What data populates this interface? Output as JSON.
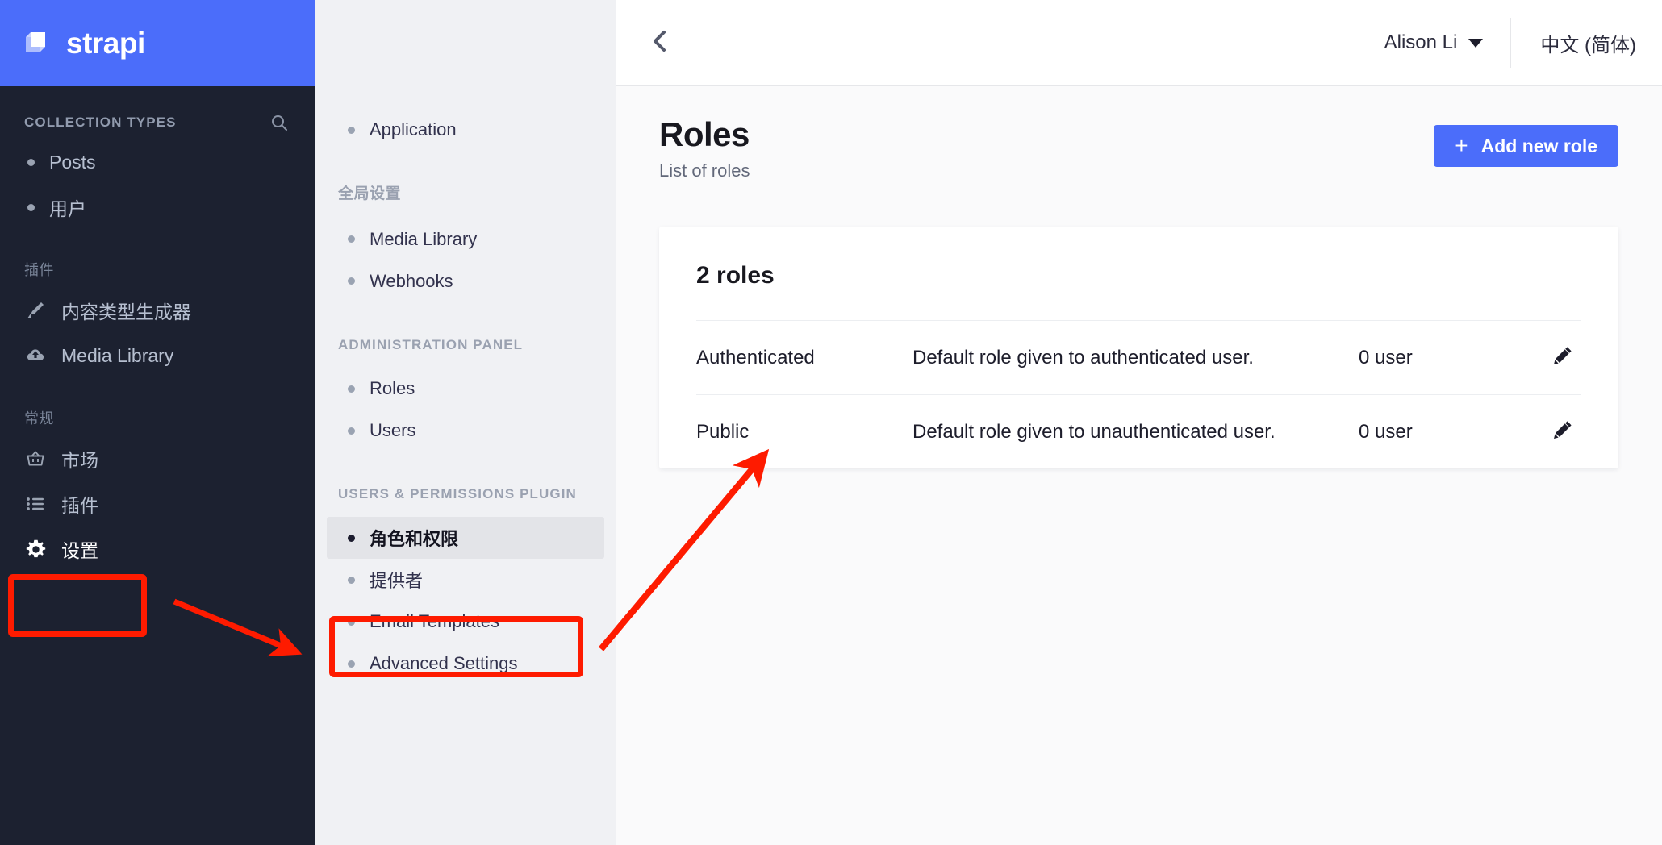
{
  "brand": {
    "name": "strapi",
    "logo_icon": "strapi-cube-icon",
    "color": "#4b6dfa"
  },
  "sidebar": {
    "collection_types": {
      "title": "COLLECTION TYPES",
      "search_icon": "search-icon",
      "items": [
        {
          "label": "Posts",
          "icon": "bullet-icon"
        },
        {
          "label": "用户",
          "icon": "bullet-icon"
        }
      ]
    },
    "plugins": {
      "title": "插件",
      "items": [
        {
          "label": "内容类型生成器",
          "icon": "paintbrush-icon"
        },
        {
          "label": "Media Library",
          "icon": "cloud-upload-icon"
        }
      ]
    },
    "general": {
      "title": "常规",
      "items": [
        {
          "label": "市场",
          "icon": "shopping-basket-icon",
          "highlighted": false
        },
        {
          "label": "插件",
          "icon": "list-icon",
          "highlighted": false
        },
        {
          "label": "设置",
          "icon": "gear-icon",
          "highlighted": true
        }
      ]
    }
  },
  "subnav": {
    "top_items": [
      {
        "label": "Application"
      }
    ],
    "groups": [
      {
        "title": "全局设置",
        "is_cn": true,
        "items": [
          {
            "label": "Media Library"
          },
          {
            "label": "Webhooks"
          }
        ]
      },
      {
        "title": "ADMINISTRATION PANEL",
        "is_cn": false,
        "items": [
          {
            "label": "Roles"
          },
          {
            "label": "Users"
          }
        ]
      },
      {
        "title": "USERS & PERMISSIONS PLUGIN",
        "is_cn": false,
        "items": [
          {
            "label": "角色和权限",
            "active": true
          },
          {
            "label": "提供者",
            "active": false
          },
          {
            "label": "Email Templates",
            "active": false
          },
          {
            "label": "Advanced Settings",
            "active": false
          }
        ]
      }
    ]
  },
  "topbar": {
    "back_icon": "chevron-left-icon",
    "user_name": "Alison Li",
    "caret_icon": "chevron-down-icon",
    "language": "中文 (简体)"
  },
  "page": {
    "title": "Roles",
    "subtitle": "List of roles",
    "add_button": {
      "label": "Add new role",
      "icon": "plus-icon",
      "color": "#4b6dfa"
    }
  },
  "roles_card": {
    "count_label": "2 roles",
    "rows": [
      {
        "name": "Authenticated",
        "description": "Default role given to authenticated user.",
        "users": "0 user",
        "edit_icon": "pencil-icon"
      },
      {
        "name": "Public",
        "description": "Default role given to unauthenticated user.",
        "users": "0 user",
        "edit_icon": "pencil-icon"
      }
    ]
  },
  "annotations": {
    "color": "#fe1b00",
    "boxes": [
      {
        "name": "settings-highlight-box"
      },
      {
        "name": "roles-permissions-highlight-box"
      }
    ],
    "arrows": [
      {
        "name": "arrow-settings-to-subnav"
      },
      {
        "name": "arrow-subnav-to-roles-card"
      }
    ]
  }
}
